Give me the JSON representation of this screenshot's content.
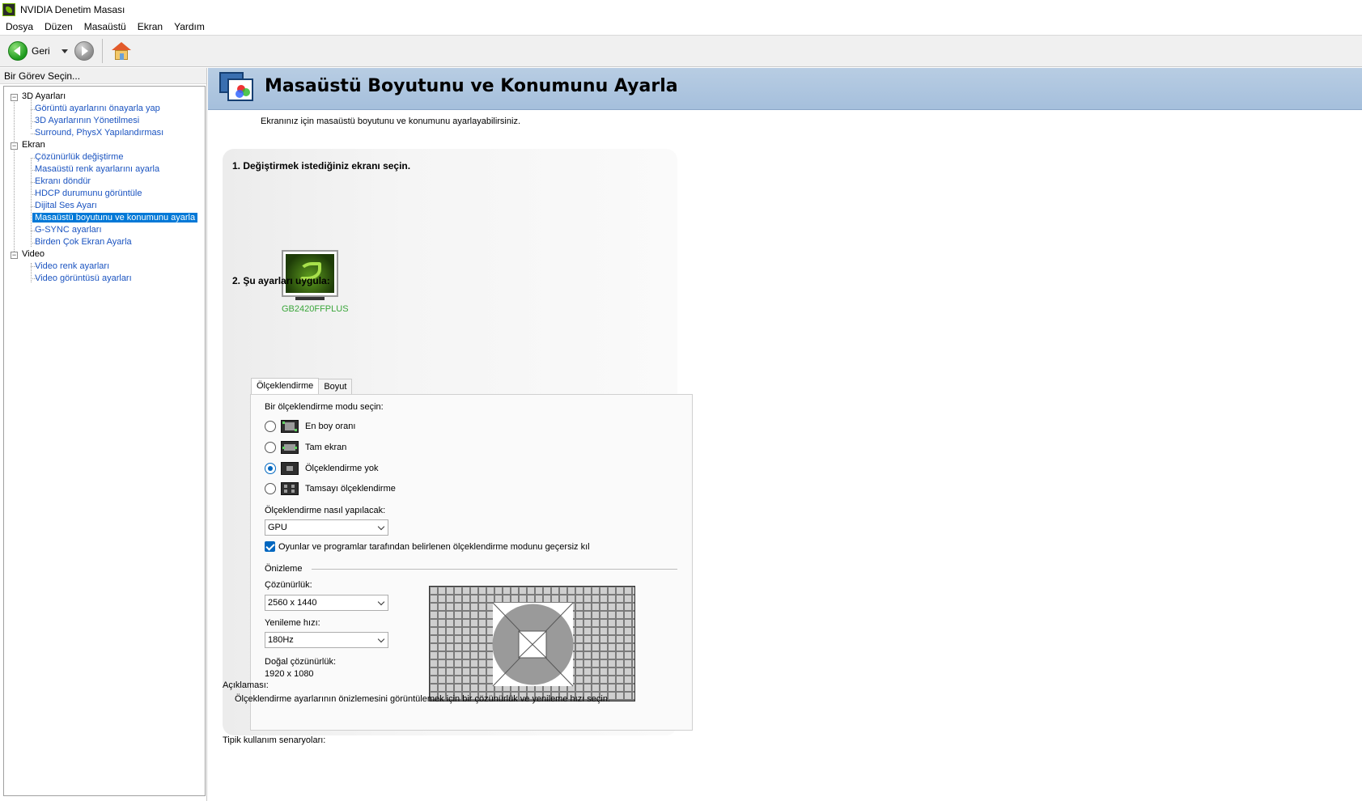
{
  "window": {
    "title": "NVIDIA Denetim Masası"
  },
  "menu": [
    "Dosya",
    "Düzen",
    "Masaüstü",
    "Ekran",
    "Yardım"
  ],
  "toolbar": {
    "back_label": "Geri"
  },
  "left_pane": {
    "header": "Bir Görev Seçin...",
    "tree": [
      {
        "label": "3D Ayarları",
        "type": "category"
      },
      {
        "label": "Görüntü ayarlarını önayarla yap",
        "type": "leaf"
      },
      {
        "label": "3D Ayarlarının Yönetilmesi",
        "type": "leaf"
      },
      {
        "label": "Surround, PhysX Yapılandırması",
        "type": "leaf"
      },
      {
        "label": "Ekran",
        "type": "category"
      },
      {
        "label": "Çözünürlük değiştirme",
        "type": "leaf"
      },
      {
        "label": "Masaüstü renk ayarlarını ayarla",
        "type": "leaf"
      },
      {
        "label": "Ekranı döndür",
        "type": "leaf"
      },
      {
        "label": "HDCP durumunu görüntüle",
        "type": "leaf"
      },
      {
        "label": "Dijital Ses Ayarı",
        "type": "leaf"
      },
      {
        "label": "Masaüstü boyutunu ve konumunu ayarla",
        "type": "leaf",
        "selected": true
      },
      {
        "label": "G-SYNC ayarları",
        "type": "leaf"
      },
      {
        "label": "Birden Çok Ekran Ayarla",
        "type": "leaf"
      },
      {
        "label": "Video",
        "type": "category"
      },
      {
        "label": "Video renk ayarları",
        "type": "leaf"
      },
      {
        "label": "Video görüntüsü ayarları",
        "type": "leaf"
      }
    ]
  },
  "page": {
    "title": "Masaüstü Boyutunu ve Konumunu Ayarla",
    "intro": "Ekranınız için masaüstü boyutunu ve konumunu ayarlayabilirsiniz.",
    "step1": "1. Değiştirmek istediğiniz ekranı seçin.",
    "display_name": "GB2420FFPLUS",
    "step2": "2. Şu ayarları uygula:",
    "tabs": [
      "Ölçeklendirme",
      "Boyut"
    ],
    "scaling_mode_label": "Bir ölçeklendirme modu seçin:",
    "modes": [
      {
        "label": "En boy oranı",
        "checked": false,
        "icon": "aspect-ratio-icon"
      },
      {
        "label": "Tam ekran",
        "checked": false,
        "icon": "full-screen-icon"
      },
      {
        "label": "Ölçeklendirme yok",
        "checked": true,
        "icon": "no-scaling-icon"
      },
      {
        "label": "Tamsayı ölçeklendirme",
        "checked": false,
        "icon": "integer-scaling-icon"
      }
    ],
    "scaling_method_label": "Ölçeklendirme nasıl yapılacak:",
    "scaling_method_value": "GPU",
    "override_label": "Oyunlar ve programlar tarafından belirlenen ölçeklendirme modunu geçersiz kıl",
    "override_checked": true,
    "preview_label": "Önizleme",
    "resolution_label": "Çözünürlük:",
    "resolution_value": "2560 x 1440",
    "refresh_label": "Yenileme hızı:",
    "refresh_value": "180Hz",
    "native_label": "Doğal çözünürlük:",
    "native_value": "1920 x 1080",
    "description_label": "Açıklaması:",
    "description_text": "Ölçeklendirme ayarlarının önizlemesini görüntülemek için bir çözünürlük ve yenileme hızı seçin.",
    "typical_label": "Tipik kullanım senaryoları:"
  },
  "colors": {
    "accent": "#0078d7",
    "banner": "#a5bfdc",
    "link": "#1a53c0",
    "nvidia_green": "#76b900"
  }
}
